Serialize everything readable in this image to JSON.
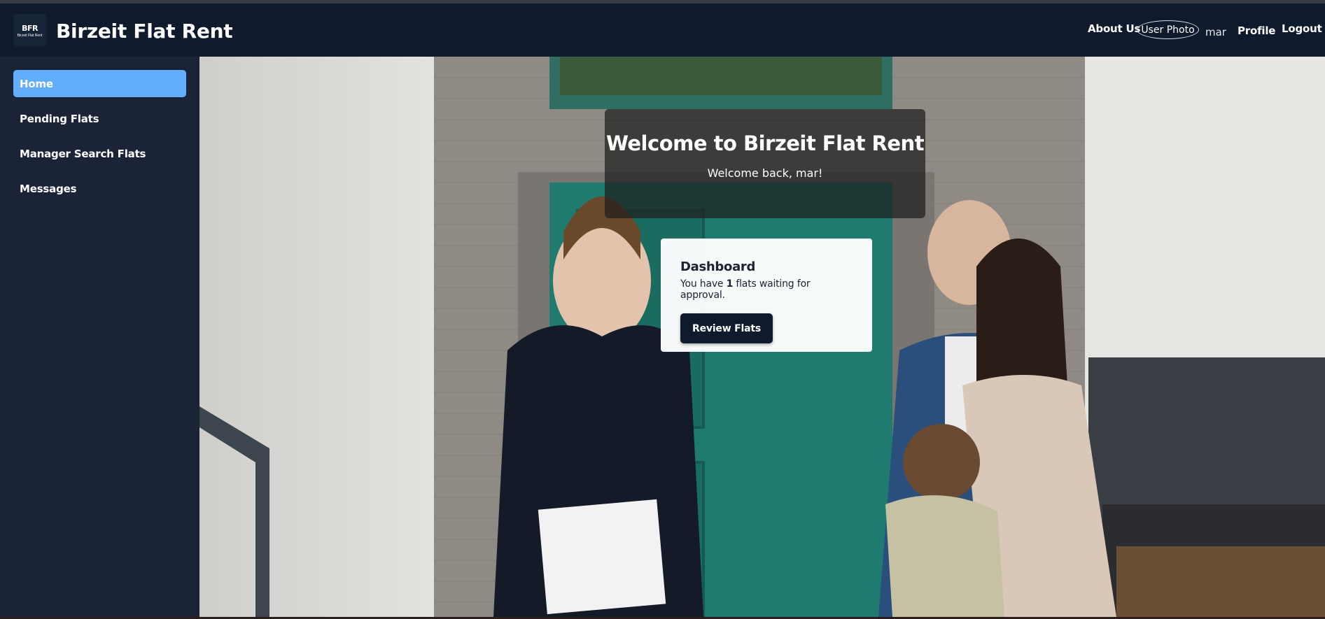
{
  "header": {
    "logo_text": "BFR",
    "logo_subtext": "Birzeit Flat Rent",
    "site_title": "Birzeit Flat Rent",
    "about_label": "About Us",
    "user_photo_alt": "User Photo",
    "username": "mar",
    "profile_label": "Profile",
    "logout_label": "Logout"
  },
  "sidebar": {
    "items": [
      {
        "label": "Home",
        "active": true
      },
      {
        "label": "Pending Flats",
        "active": false
      },
      {
        "label": "Manager Search Flats",
        "active": false
      },
      {
        "label": "Messages",
        "active": false
      }
    ]
  },
  "main": {
    "welcome_title": "Welcome to Birzeit Flat Rent",
    "welcome_subtitle": "Welcome back, mar!",
    "dashboard": {
      "title": "Dashboard",
      "text_before": "You have ",
      "count": "1",
      "text_after": " flats waiting for approval.",
      "button_label": "Review Flats"
    }
  },
  "colors": {
    "header_bg": "#0f1b2c",
    "sidebar_bg": "#1b2437",
    "active_item": "#62aefc",
    "button_bg": "#0f1b2c"
  }
}
